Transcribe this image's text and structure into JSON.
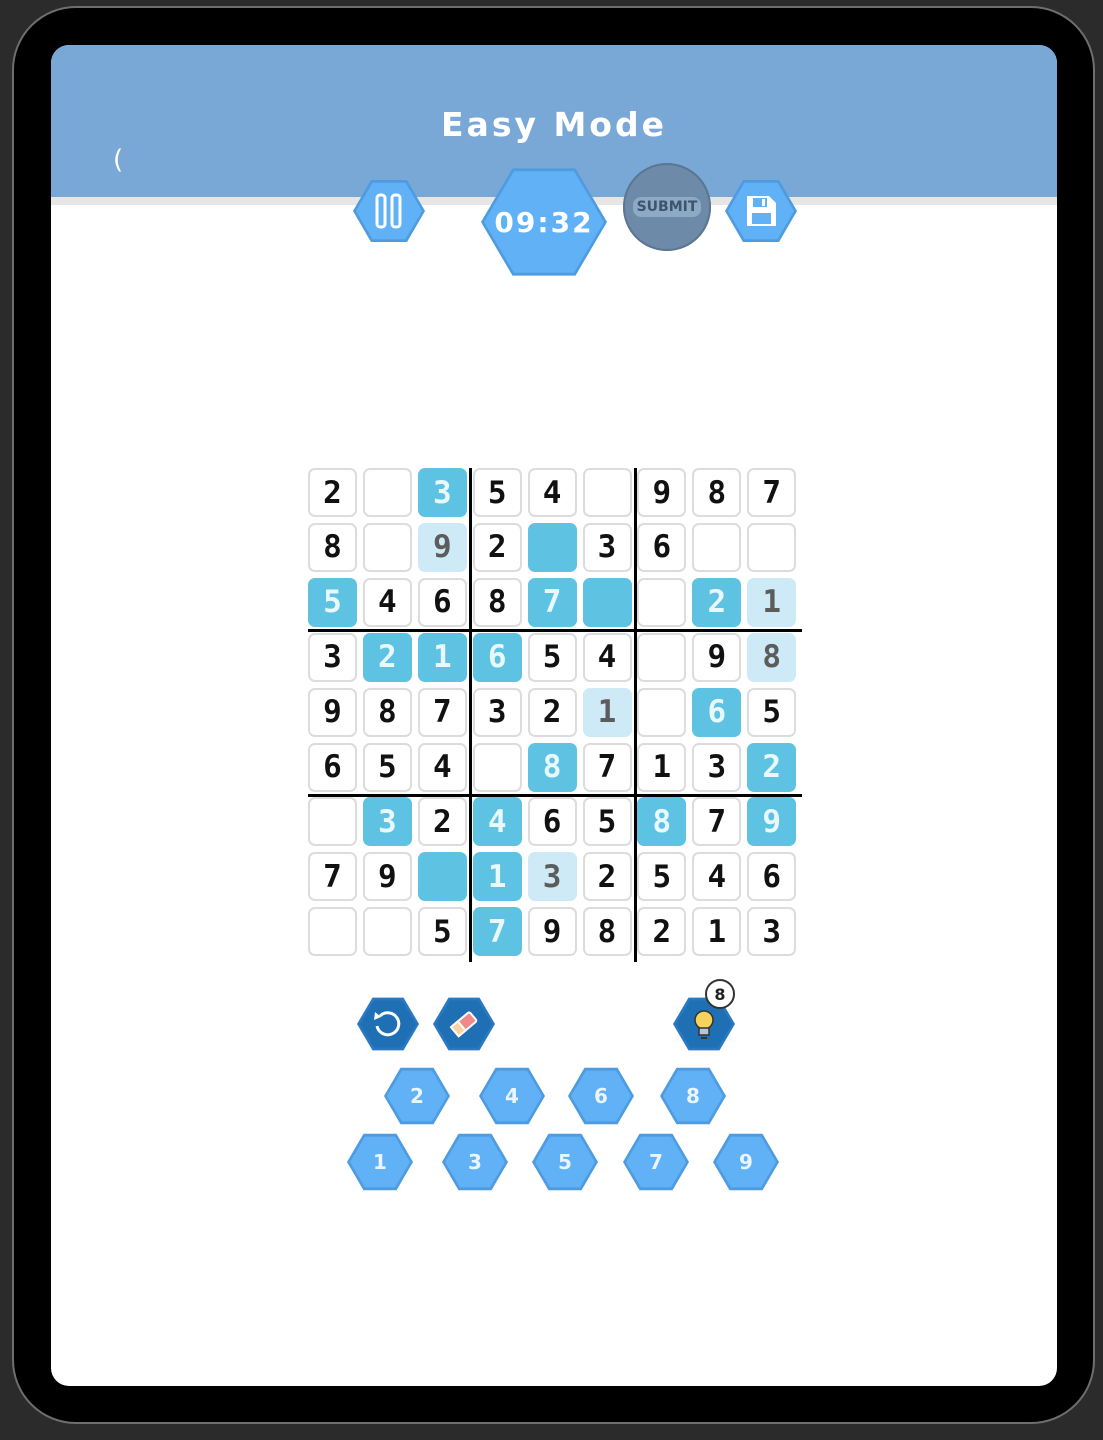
{
  "header": {
    "title": "Easy Mode",
    "back_label": "(",
    "timer": "09:32",
    "submit_label": "SUBMIT"
  },
  "colors": {
    "header_bg": "#7aa8d6",
    "hex_button": "#60b1f6",
    "given_cell_highlight": "#5ec3e3",
    "light_cell_highlight": "#cfeaf7"
  },
  "icons": {
    "pause": "pause-icon",
    "save": "save-icon",
    "undo": "undo-icon",
    "erase": "eraser-icon",
    "hint": "lightbulb-icon"
  },
  "board": [
    [
      [
        "2",
        ""
      ],
      [
        "",
        ""
      ],
      [
        "3",
        "blue"
      ],
      [
        "5",
        ""
      ],
      [
        "4",
        ""
      ],
      [
        "",
        ""
      ],
      [
        "9",
        ""
      ],
      [
        "8",
        ""
      ],
      [
        "7",
        ""
      ]
    ],
    [
      [
        "8",
        ""
      ],
      [
        "",
        ""
      ],
      [
        "9",
        "light"
      ],
      [
        "2",
        ""
      ],
      [
        "",
        "blue"
      ],
      [
        "3",
        ""
      ],
      [
        "6",
        ""
      ],
      [
        "",
        ""
      ],
      [
        "",
        ""
      ]
    ],
    [
      [
        "5",
        "blue"
      ],
      [
        "4",
        ""
      ],
      [
        "6",
        ""
      ],
      [
        "8",
        ""
      ],
      [
        "7",
        "blue"
      ],
      [
        "",
        "blue"
      ],
      [
        "",
        ""
      ],
      [
        "2",
        "blue"
      ],
      [
        "1",
        "light"
      ]
    ],
    [
      [
        "3",
        ""
      ],
      [
        "2",
        "blue"
      ],
      [
        "1",
        "blue"
      ],
      [
        "6",
        "blue"
      ],
      [
        "5",
        ""
      ],
      [
        "4",
        ""
      ],
      [
        "",
        ""
      ],
      [
        "9",
        ""
      ],
      [
        "8",
        "light"
      ]
    ],
    [
      [
        "9",
        ""
      ],
      [
        "8",
        ""
      ],
      [
        "7",
        ""
      ],
      [
        "3",
        ""
      ],
      [
        "2",
        ""
      ],
      [
        "1",
        "light"
      ],
      [
        "",
        ""
      ],
      [
        "6",
        "blue"
      ],
      [
        "5",
        ""
      ]
    ],
    [
      [
        "6",
        ""
      ],
      [
        "5",
        ""
      ],
      [
        "4",
        ""
      ],
      [
        "",
        ""
      ],
      [
        "8",
        "blue"
      ],
      [
        "7",
        ""
      ],
      [
        "1",
        ""
      ],
      [
        "3",
        ""
      ],
      [
        "2",
        "blue"
      ]
    ],
    [
      [
        "",
        ""
      ],
      [
        "3",
        "blue"
      ],
      [
        "2",
        ""
      ],
      [
        "4",
        "blue"
      ],
      [
        "6",
        ""
      ],
      [
        "5",
        ""
      ],
      [
        "8",
        "blue"
      ],
      [
        "7",
        ""
      ],
      [
        "9",
        "blue"
      ]
    ],
    [
      [
        "7",
        ""
      ],
      [
        "9",
        ""
      ],
      [
        "",
        "blue"
      ],
      [
        "1",
        "blue"
      ],
      [
        "3",
        "light"
      ],
      [
        "2",
        ""
      ],
      [
        "5",
        ""
      ],
      [
        "4",
        ""
      ],
      [
        "6",
        ""
      ]
    ],
    [
      [
        "",
        ""
      ],
      [
        "",
        ""
      ],
      [
        "5",
        ""
      ],
      [
        "7",
        "blue"
      ],
      [
        "9",
        ""
      ],
      [
        "8",
        ""
      ],
      [
        "2",
        ""
      ],
      [
        "1",
        ""
      ],
      [
        "3",
        ""
      ]
    ]
  ],
  "hint_count": "8",
  "number_pad": {
    "row1": [
      "2",
      "4",
      "6",
      "8"
    ],
    "row2": [
      "1",
      "3",
      "5",
      "7",
      "9"
    ]
  }
}
